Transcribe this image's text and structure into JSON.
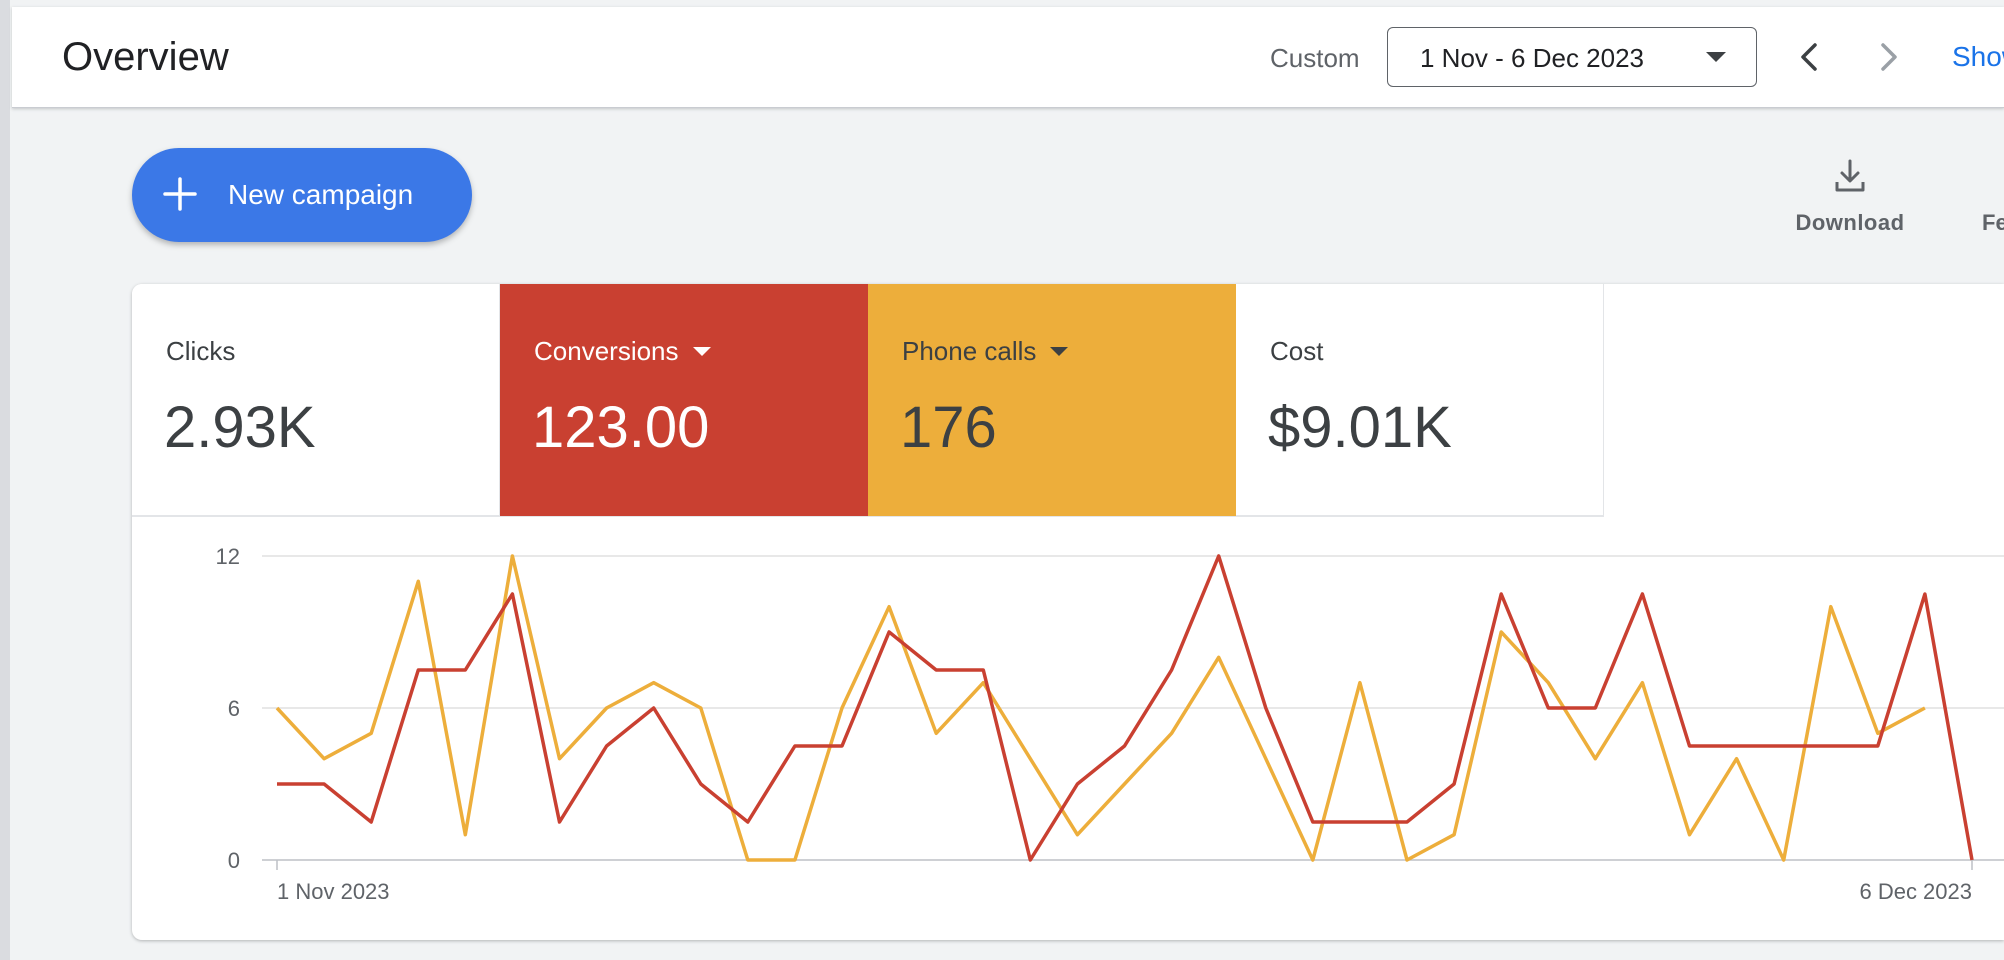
{
  "header": {
    "title": "Overview",
    "range_label": "Custom",
    "date_range": "1 Nov - 6 Dec 2023",
    "show_link": "Show"
  },
  "actions": {
    "new_campaign_label": "New campaign",
    "download_label": "Download",
    "more_label": "Fe"
  },
  "metrics": [
    {
      "title": "Clicks",
      "value": "2.93K",
      "selected": false
    },
    {
      "title": "Conversions",
      "value": "123.00",
      "selected": true,
      "color": "#c94031"
    },
    {
      "title": "Phone calls",
      "value": "176",
      "selected": true,
      "color": "#edae3b"
    },
    {
      "title": "Cost",
      "value": "$9.01K",
      "selected": false
    }
  ],
  "chart_data": {
    "type": "line",
    "x_start_label": "1 Nov 2023",
    "x_end_label": "6 Dec 2023",
    "y_ticks": [
      "12",
      "6",
      "0"
    ],
    "ylim": [
      0,
      12
    ],
    "grid": true,
    "series": [
      {
        "name": "Conversions",
        "color": "#c94031",
        "values": [
          3,
          3,
          1.5,
          7.5,
          7.5,
          10.5,
          1.5,
          4.5,
          6,
          3,
          1.5,
          4.5,
          4.5,
          9,
          7.5,
          7.5,
          0,
          3,
          4.5,
          7.5,
          12,
          6,
          1.5,
          1.5,
          1.5,
          3,
          10.5,
          6,
          6,
          10.5,
          4.5,
          4.5,
          4.5,
          4.5,
          4.5,
          10.5,
          0
        ]
      },
      {
        "name": "Phone calls",
        "color": "#edae3b",
        "values": [
          6,
          4,
          5,
          11,
          1,
          12,
          4,
          6,
          7,
          6,
          0,
          0,
          6,
          10,
          5,
          7,
          4,
          1,
          3,
          5,
          8,
          4,
          0,
          7,
          0,
          1,
          9,
          7,
          4,
          7,
          1,
          4,
          0,
          10,
          5,
          6
        ]
      }
    ]
  }
}
